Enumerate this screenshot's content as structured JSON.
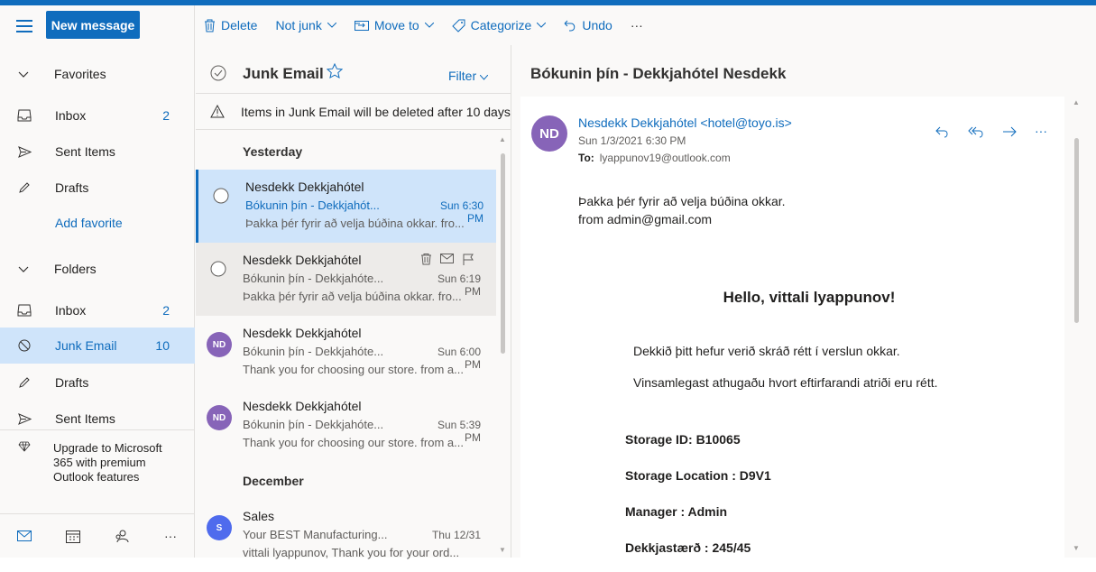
{
  "toolbar": {
    "new_message": "New message",
    "delete": "Delete",
    "not_junk": "Not junk",
    "move_to": "Move to",
    "categorize": "Categorize",
    "undo": "Undo",
    "more": "···"
  },
  "nav": {
    "favorites": "Favorites",
    "fav_items": [
      {
        "label": "Inbox",
        "count": "2",
        "icon": "inbox-icon"
      },
      {
        "label": "Sent Items",
        "count": "",
        "icon": "send-icon"
      },
      {
        "label": "Drafts",
        "count": "",
        "icon": "pencil-icon"
      }
    ],
    "add_favorite": "Add favorite",
    "folders": "Folders",
    "folder_items": [
      {
        "label": "Inbox",
        "count": "2",
        "icon": "inbox-icon"
      },
      {
        "label": "Junk Email",
        "count": "10",
        "icon": "block-icon",
        "selected": true
      },
      {
        "label": "Drafts",
        "count": "",
        "icon": "pencil-icon"
      },
      {
        "label": "Sent Items",
        "count": "",
        "icon": "send-icon"
      }
    ],
    "upgrade": "Upgrade to Microsoft 365 with premium Outlook features"
  },
  "list": {
    "title": "Junk Email",
    "filter": "Filter",
    "notice": "Items in Junk Email will be deleted after 10 days",
    "groups": [
      "Yesterday",
      "December"
    ],
    "messages": [
      {
        "from": "Nesdekk Dekkjahótel",
        "subject": "Bókunin þín - Dekkjahót...",
        "time": "Sun 6:30 PM",
        "preview": "Þakka þér fyrir að velja búðina okkar. fro...",
        "selected": true
      },
      {
        "from": "Nesdekk Dekkjahótel",
        "subject": "Bókunin þín - Dekkjahóte...",
        "time": "Sun 6:19 PM",
        "preview": "Þakka þér fyrir að velja búðina okkar. fro..."
      },
      {
        "from": "Nesdekk Dekkjahótel",
        "subject": "Bókunin þín - Dekkjahóte...",
        "time": "Sun 6:00 PM",
        "preview": "Thank you for choosing our store. from a...",
        "avatar": "ND"
      },
      {
        "from": "Nesdekk Dekkjahótel",
        "subject": "Bókunin þín - Dekkjahóte...",
        "time": "Sun 5:39 PM",
        "preview": "Thank you for choosing our store. from a...",
        "avatar": "ND"
      },
      {
        "from": "Sales",
        "subject": "Your BEST Manufacturing...",
        "time": "Thu 12/31",
        "preview": "vittali lyappunov, Thank you for your ord...",
        "avatar": "S"
      }
    ]
  },
  "reader": {
    "title": "Bókunin þín - Dekkjahótel Nesdekk",
    "avatar": "ND",
    "sender": "Nesdekk Dekkjahótel <hotel@toyo.is>",
    "date": "Sun 1/3/2021 6:30 PM",
    "to_label": "To:",
    "to": "lyappunov19@outlook.com",
    "body_line1": "Þakka þér fyrir að velja búðina okkar.",
    "body_line2": "from admin@gmail.com",
    "hello": "Hello, vittali lyappunov!",
    "para1": "Dekkið þitt hefur verið skráð rétt í verslun okkar.",
    "para2": "Vinsamlegast athugaðu hvort eftirfarandi atriði eru rétt.",
    "fields": [
      "Storage ID: B10065",
      "Storage Location : D9V1",
      "Manager : Admin",
      "Dekkjastærð : 245/45"
    ]
  },
  "colors": {
    "accent": "#0f6cbd",
    "avatar_nd": "#8764b8",
    "avatar_s": "#4f6bed",
    "selected_bg": "#cfe4fa"
  }
}
